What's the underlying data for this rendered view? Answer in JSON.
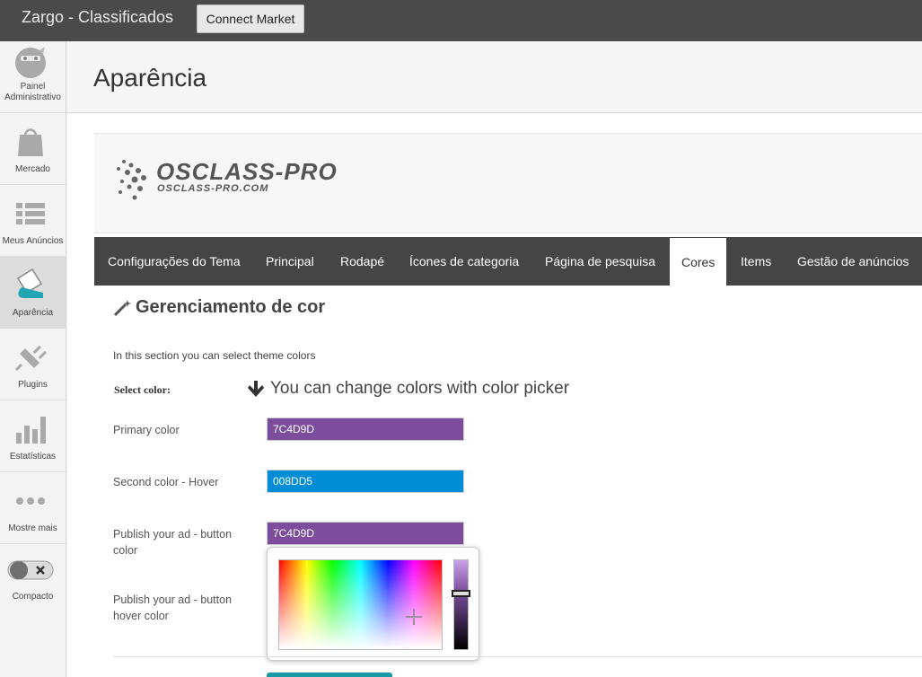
{
  "topbar": {
    "title": "Zargo - Classificados",
    "connect_button": "Connect Market"
  },
  "sidebar": {
    "items": [
      {
        "label": "Painel Administrativo",
        "icon": "dashboard-icon"
      },
      {
        "label": "Mercado",
        "icon": "shopping-bag-icon"
      },
      {
        "label": "Meus Anúncios",
        "icon": "list-icon"
      },
      {
        "label": "Aparência",
        "icon": "paint-bucket-icon",
        "active": true
      },
      {
        "label": "Plugins",
        "icon": "plug-icon"
      },
      {
        "label": "Estatísticas",
        "icon": "bar-chart-icon"
      },
      {
        "label": "Mostre mais",
        "icon": "more-dots-icon"
      },
      {
        "label": "Compacto",
        "icon": "toggle-icon"
      }
    ]
  },
  "page": {
    "title": "Aparência"
  },
  "logo": {
    "main": "OSCLASS-PRO",
    "sub": "OSCLASS-PRO.COM"
  },
  "tabs": [
    {
      "label": "Configurações do Tema"
    },
    {
      "label": "Principal"
    },
    {
      "label": "Rodapé"
    },
    {
      "label": "Ícones de categoria"
    },
    {
      "label": "Página de pesquisa"
    },
    {
      "label": "Cores",
      "active": true
    },
    {
      "label": "Items"
    },
    {
      "label": "Gestão de anúncios"
    }
  ],
  "section": {
    "title": "Gerenciamento de cor",
    "intro": "In this section you can select theme colors",
    "select_label": "Select color:",
    "hint": "You can change colors with color picker"
  },
  "fields": [
    {
      "label": "Primary color",
      "value": "7C4D9D",
      "color": "#7C4D9D"
    },
    {
      "label": "Second color - Hover",
      "value": "008DD5",
      "color": "#008DD5"
    },
    {
      "label": "Publish your ad - button color",
      "value": "7C4D9D",
      "color": "#7C4D9D"
    },
    {
      "label": "Publish your ad - button hover color",
      "value": "",
      "color": ""
    }
  ],
  "colors": {
    "topbar": "#4a4a4a",
    "tabbar": "#454545",
    "accent_teal": "#1a9aa8"
  }
}
